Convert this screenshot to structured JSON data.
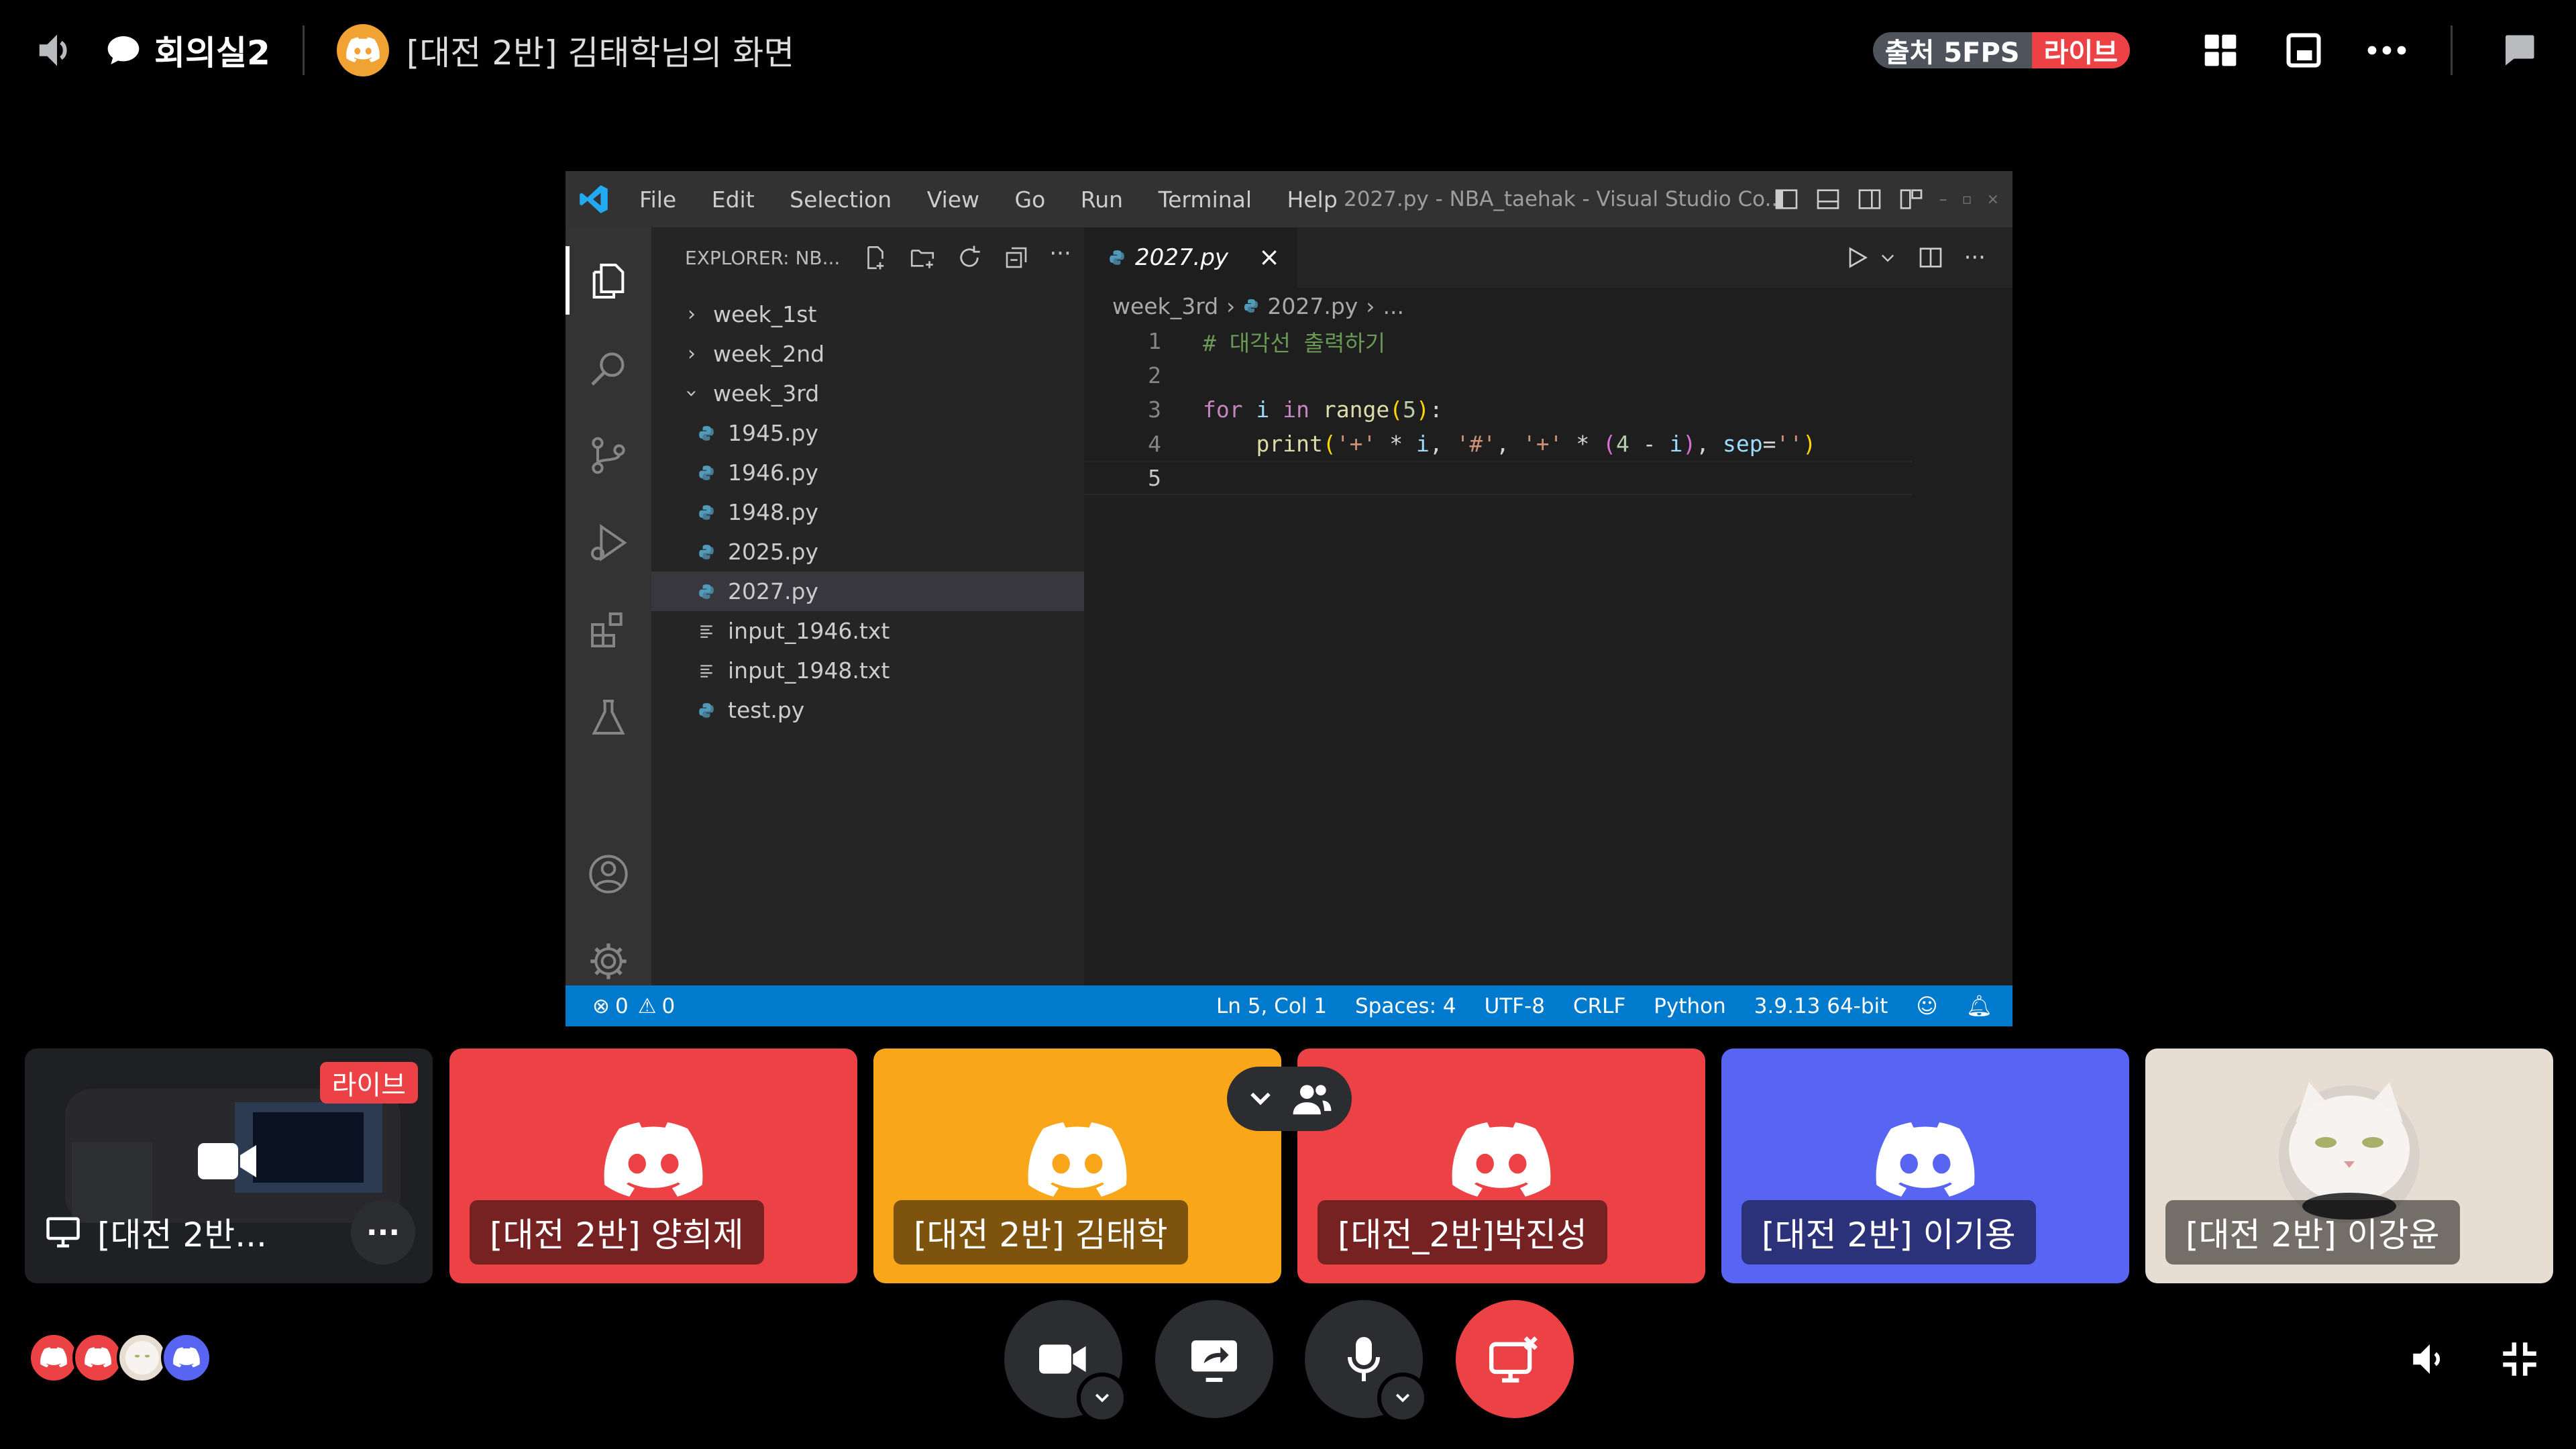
{
  "topbar": {
    "room_name": "회의실2",
    "stream_title": "[대전 2반] 김태학님의 화면",
    "badge_capture": "출처 5FPS",
    "badge_live": "라이브"
  },
  "vscode": {
    "menu": [
      "File",
      "Edit",
      "Selection",
      "View",
      "Go",
      "Run",
      "Terminal",
      "Help"
    ],
    "window_title": "2027.py - NBA_taehak - Visual Studio Co...",
    "explorer_title": "EXPLORER: NB...",
    "tree": [
      {
        "label": "week_1st",
        "type": "folder-closed"
      },
      {
        "label": "week_2nd",
        "type": "folder-closed"
      },
      {
        "label": "week_3rd",
        "type": "folder-open"
      },
      {
        "label": "1945.py",
        "type": "py"
      },
      {
        "label": "1946.py",
        "type": "py"
      },
      {
        "label": "1948.py",
        "type": "py"
      },
      {
        "label": "2025.py",
        "type": "py"
      },
      {
        "label": "2027.py",
        "type": "py",
        "selected": true
      },
      {
        "label": "input_1946.txt",
        "type": "txt"
      },
      {
        "label": "input_1948.txt",
        "type": "txt"
      },
      {
        "label": "test.py",
        "type": "py"
      }
    ],
    "tab_label": "2027.py",
    "breadcrumb": {
      "folder": "week_3rd",
      "file": "2027.py",
      "rest": "..."
    },
    "code_lines": [
      "1",
      "2",
      "3",
      "4",
      "5"
    ],
    "status": {
      "errors": "0",
      "warnings": "0",
      "position": "Ln 5, Col 1",
      "spaces": "Spaces: 4",
      "encoding": "UTF-8",
      "eol": "CRLF",
      "language": "Python",
      "interpreter": "3.9.13 64-bit"
    }
  },
  "tiles": {
    "self_name": "[대전 2반...",
    "self_live": "라이브",
    "participants": [
      {
        "name": "[대전 2반] 양희제",
        "color": "#ed4245"
      },
      {
        "name": "[대전 2반] 김태학",
        "color": "#faa61a"
      },
      {
        "name": "[대전_2반]박진성",
        "color": "#ed4245"
      },
      {
        "name": "[대전 2반] 이기용",
        "color": "#5865f2"
      },
      {
        "name": "[대전 2반] 이강윤",
        "color": "#e8ddd2"
      }
    ]
  },
  "colors": {
    "discord_red": "#ed4245",
    "discord_yellow": "#faa61a",
    "discord_blurple": "#5865f2",
    "vscode_blue": "#007acc"
  }
}
